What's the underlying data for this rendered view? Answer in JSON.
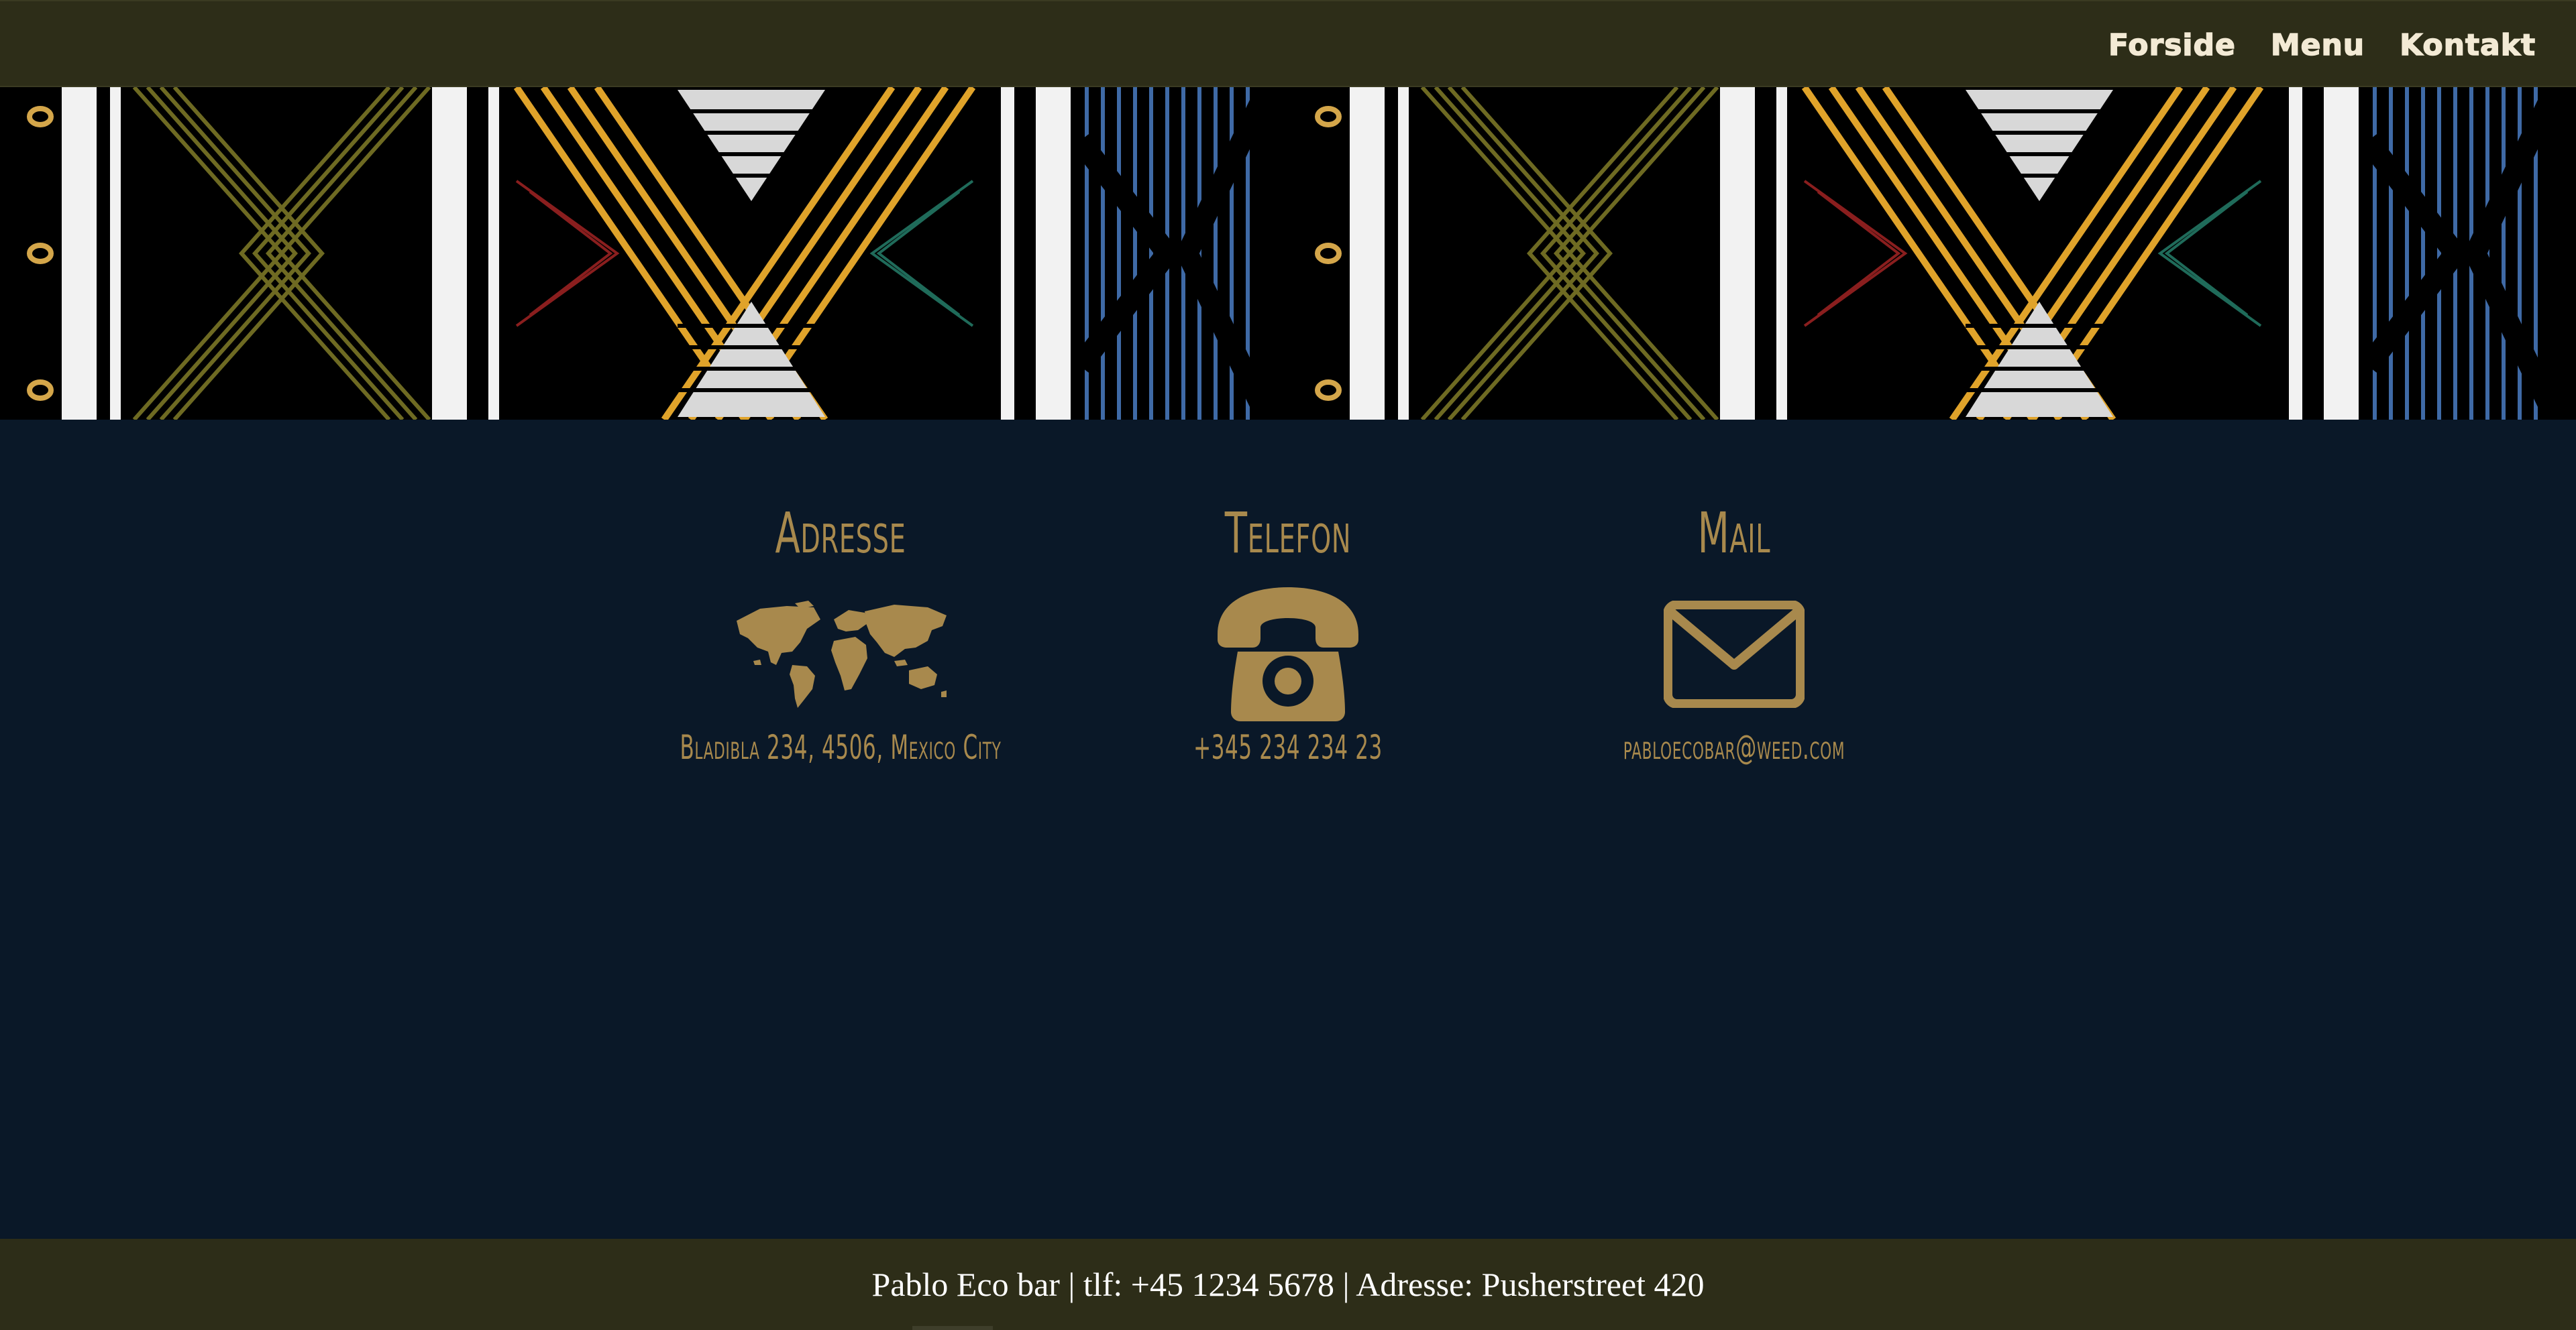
{
  "nav": {
    "links": [
      {
        "label": "Forside"
      },
      {
        "label": "Menu"
      },
      {
        "label": "Kontakt"
      }
    ]
  },
  "banner": {
    "alt": "decorative tribal pattern banner"
  },
  "contact": {
    "columns": [
      {
        "title": "Adresse",
        "icon": "world-map-icon",
        "value": "Bladibla 234, 4506, Mexico City"
      },
      {
        "title": "Telefon",
        "icon": "telephone-icon",
        "value": "+345 234 234 23"
      },
      {
        "title": "Mail",
        "icon": "envelope-icon",
        "value": "pabloecobar@weed.com"
      }
    ]
  },
  "footer": {
    "text": "Pablo Eco bar | tlf: +45 1234 5678 | Adresse: Pusherstreet 420"
  },
  "colors": {
    "nav_bg": "#2d2d18",
    "page_bg": "#0a1828",
    "accent": "#a8894d",
    "nav_text": "#f3ead5"
  }
}
